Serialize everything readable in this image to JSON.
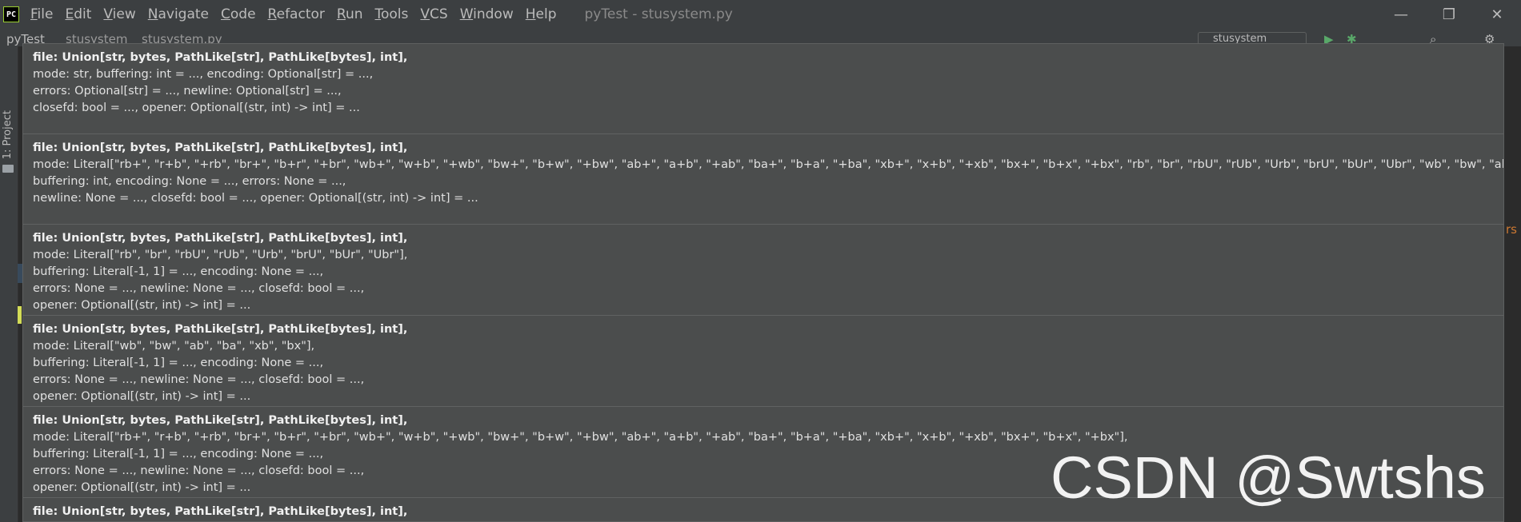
{
  "app": {
    "logo_text": "PC",
    "window_title": "pyTest - stusystem.py"
  },
  "menu": [
    {
      "mnemonic": "F",
      "rest": "ile"
    },
    {
      "mnemonic": "E",
      "rest": "dit"
    },
    {
      "mnemonic": "V",
      "rest": "iew"
    },
    {
      "mnemonic": "N",
      "rest": "avigate"
    },
    {
      "mnemonic": "C",
      "rest": "ode"
    },
    {
      "mnemonic": "R",
      "rest": "efactor"
    },
    {
      "mnemonic": "R",
      "rest": "un"
    },
    {
      "mnemonic": "T",
      "rest": "ools"
    },
    {
      "mnemonic": "V",
      "rest": "CS"
    },
    {
      "mnemonic": "W",
      "rest": "indow"
    },
    {
      "mnemonic": "H",
      "rest": "elp"
    }
  ],
  "window_controls": {
    "minimize": "—",
    "restore": "❐",
    "close": "✕"
  },
  "navbar": {
    "project": "pyTest",
    "folder": "stusystem",
    "file": "stusystem.py",
    "run_config": "stusystem"
  },
  "side_panel": {
    "project_tab": "1: Project"
  },
  "gutter_fragment": "rs",
  "popup": {
    "signatures": [
      {
        "head": "file: Union[str, bytes, PathLike[str], PathLike[bytes], int],",
        "lines": [
          "mode: str, buffering: int = ..., encoding: Optional[str] = ...,",
          "errors: Optional[str] = ..., newline: Optional[str] = ...,",
          "closefd: bool = ..., opener: Optional[(str, int) -> int] = ..."
        ]
      },
      {
        "head": "file: Union[str, bytes, PathLike[str], PathLike[bytes], int],",
        "lines": [
          "mode: Literal[\"rb+\", \"r+b\", \"+rb\", \"br+\", \"b+r\", \"+br\", \"wb+\", \"w+b\", \"+wb\", \"bw+\", \"b+w\", \"+bw\", \"ab+\", \"a+b\", \"+ab\", \"ba+\", \"b+a\", \"+ba\", \"xb+\", \"x+b\", \"+xb\", \"bx+\", \"b+x\", \"+bx\", \"rb\", \"br\", \"rbU\", \"rUb\", \"Urb\", \"brU\", \"bUr\", \"Ubr\", \"wb\", \"bw\", \"ab\", \"",
          "buffering: int, encoding: None = ..., errors: None = ...,",
          "newline: None = ..., closefd: bool = ..., opener: Optional[(str, int) -> int] = ..."
        ]
      },
      {
        "head": "file: Union[str, bytes, PathLike[str], PathLike[bytes], int],",
        "lines": [
          "mode: Literal[\"rb\", \"br\", \"rbU\", \"rUb\", \"Urb\", \"brU\", \"bUr\", \"Ubr\"],",
          "buffering: Literal[-1, 1] = ..., encoding: None = ...,",
          "errors: None = ..., newline: None = ..., closefd: bool = ...,",
          "opener: Optional[(str, int) -> int] = ..."
        ]
      },
      {
        "head": "file: Union[str, bytes, PathLike[str], PathLike[bytes], int],",
        "lines": [
          "mode: Literal[\"wb\", \"bw\", \"ab\", \"ba\", \"xb\", \"bx\"],",
          "buffering: Literal[-1, 1] = ..., encoding: None = ...,",
          "errors: None = ..., newline: None = ..., closefd: bool = ...,",
          "opener: Optional[(str, int) -> int] = ..."
        ]
      },
      {
        "head": "file: Union[str, bytes, PathLike[str], PathLike[bytes], int],",
        "lines": [
          "mode: Literal[\"rb+\", \"r+b\", \"+rb\", \"br+\", \"b+r\", \"+br\", \"wb+\", \"w+b\", \"+wb\", \"bw+\", \"b+w\", \"+bw\", \"ab+\", \"a+b\", \"+ab\", \"ba+\", \"b+a\", \"+ba\", \"xb+\", \"x+b\", \"+xb\", \"bx+\", \"b+x\", \"+bx\"],",
          "buffering: Literal[-1, 1] = ..., encoding: None = ...,",
          "errors: None = ..., newline: None = ..., closefd: bool = ...,",
          "opener: Optional[(str, int) -> int] = ..."
        ]
      },
      {
        "head": "file: Union[str, bytes, PathLike[str], PathLike[bytes], int],",
        "lines": []
      }
    ]
  },
  "watermark": "CSDN @Swtshs",
  "colors": {
    "background": "#2b2b2b",
    "titlebar": "#3c3f41",
    "popup": "#4b4d4d",
    "keyword": "#cc7832"
  }
}
